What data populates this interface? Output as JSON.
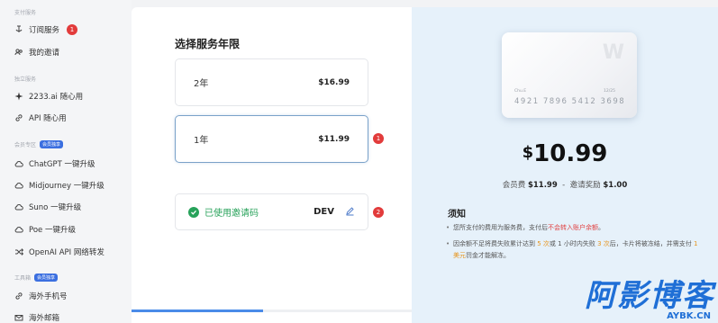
{
  "sidebar": {
    "sections": [
      {
        "label": "支付服务"
      },
      {
        "label": "独立服务"
      },
      {
        "label": "会员专区",
        "tag": "会员独享"
      },
      {
        "label": "工具箱",
        "tag": "会员独享"
      }
    ],
    "items": [
      {
        "label": "订阅服务",
        "icon": "subscribe-icon",
        "badge": "1"
      },
      {
        "label": "我的邀请",
        "icon": "users-icon"
      },
      {
        "label": "2233.ai 随心用",
        "icon": "sparkle-icon"
      },
      {
        "label": "API 随心用",
        "icon": "link-icon"
      },
      {
        "label": "ChatGPT 一键升级",
        "icon": "cloud-icon"
      },
      {
        "label": "Midjourney 一键升级",
        "icon": "cloud-icon"
      },
      {
        "label": "Suno 一键升级",
        "icon": "cloud-icon"
      },
      {
        "label": "Poe 一键升级",
        "icon": "cloud-icon"
      },
      {
        "label": "OpenAI API 网络转发",
        "icon": "shuffle-icon"
      },
      {
        "label": "海外手机号",
        "icon": "link-icon"
      },
      {
        "label": "海外邮箱",
        "icon": "mail-icon"
      }
    ]
  },
  "main": {
    "title": "选择服务年限",
    "options": [
      {
        "label": "2年",
        "price": "$16.99"
      },
      {
        "label": "1年",
        "price": "$11.99",
        "badge": "1"
      }
    ],
    "invite": {
      "label": "已使用邀请码",
      "code": "DEV",
      "badge": "2"
    }
  },
  "right": {
    "card": {
      "letter": "W",
      "holder": "Chu.E",
      "expiry": "12/25",
      "number": "4921 7896 5412 3698"
    },
    "price_currency": "$",
    "price_value": "10.99",
    "breakdown": {
      "fee_label": "会员费",
      "fee": "$11.99",
      "sep": "-",
      "reward_label": "邀请奖励",
      "reward": "$1.00"
    },
    "notice_title": "须知",
    "notice1": {
      "a": "您所支付的费用为服务费，支付后",
      "b": "不会转入账户余额",
      "c": "。"
    },
    "notice2": {
      "a": "因余额不足将费失败累计达到 ",
      "b": "5 次",
      "c": "或 1 小时内失败 ",
      "d": "3 次",
      "e": "后，卡片将被冻结，并需支付 ",
      "f": "1 美元",
      "g": "罚金才能解冻。"
    }
  },
  "watermark": {
    "main": "阿影博客",
    "sub": "AYBK.CN"
  },
  "colors": {
    "accent": "#4a8be8",
    "success": "#27a25a",
    "badge": "#e23b3b",
    "highlight_red": "#e04040",
    "highlight_orange": "#e6951e"
  }
}
